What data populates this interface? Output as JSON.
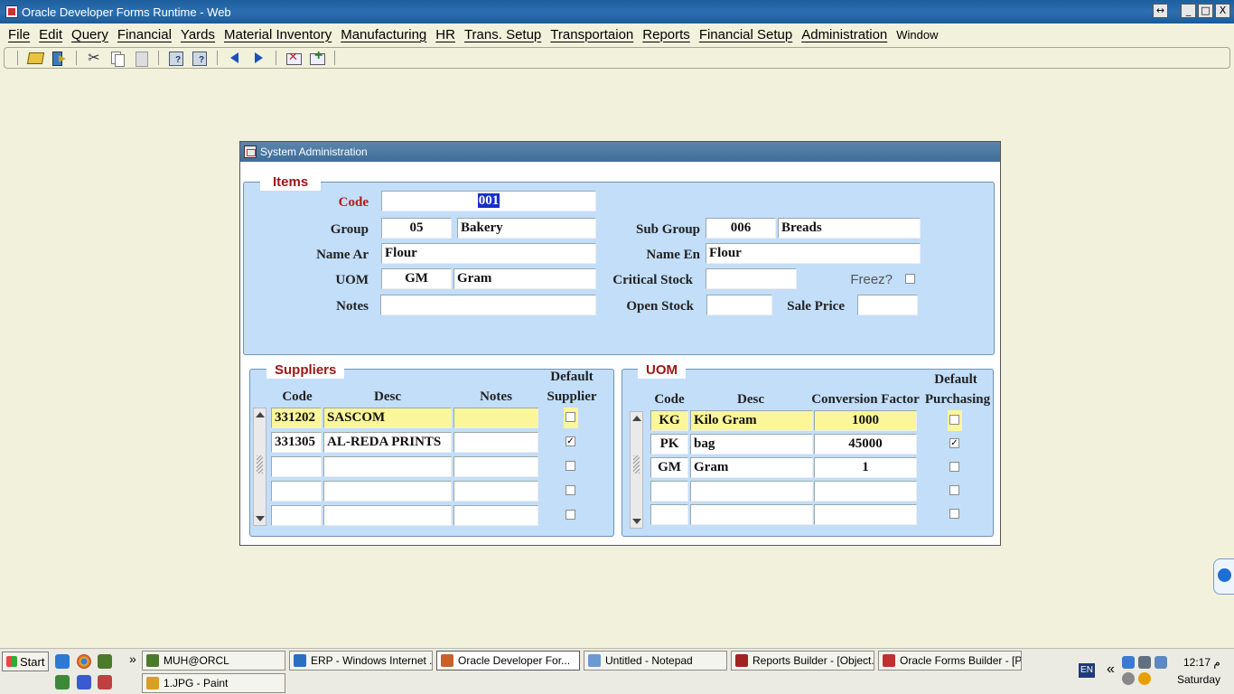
{
  "window": {
    "title": "Oracle Developer Forms Runtime - Web",
    "restore_glyph": "↔",
    "min_glyph": "_",
    "max_glyph": "□",
    "close_glyph": "X"
  },
  "menu": [
    "File",
    "Edit",
    "Query",
    "Financial",
    "Yards",
    "Material Inventory",
    "Manufacturing",
    "HR",
    "Trans. Setup",
    "Transportaion",
    "Reports",
    "Financial Setup",
    "Administration",
    "Window"
  ],
  "toolbar_icons": [
    "open-icon",
    "exit-icon",
    "cut-icon",
    "copy-icon",
    "paste-icon",
    "enter-query-icon",
    "execute-query-icon",
    "previous-record-icon",
    "next-record-icon",
    "delete-record-icon",
    "insert-record-icon"
  ],
  "dialog": {
    "title": "System Administration",
    "items": {
      "legend": "Items",
      "code_label": "Code",
      "code_value": "001",
      "group_label": "Group",
      "group_code": "05",
      "group_name": "Bakery",
      "subgroup_label": "Sub Group",
      "subgroup_code": "006",
      "subgroup_name": "Breads",
      "name_ar_label": "Name Ar",
      "name_ar": "Flour",
      "name_en_label": "Name En",
      "name_en": "Flour",
      "uom_label": "UOM",
      "uom_code": "GM",
      "uom_name": "Gram",
      "critical_stock_label": "Critical Stock",
      "critical_stock": "",
      "freez_label": "Freez?",
      "notes_label": "Notes",
      "notes": "",
      "open_stock_label": "Open Stock",
      "open_stock": "",
      "sale_price_label": "Sale Price",
      "sale_price": ""
    },
    "suppliers": {
      "legend": "Suppliers",
      "headers": {
        "code": "Code",
        "desc": "Desc",
        "notes": "Notes",
        "default1": "Default",
        "default2": "Supplier"
      },
      "rows": [
        {
          "code": "331202",
          "desc": "SASCOM",
          "notes": "",
          "default": ""
        },
        {
          "code": "331305",
          "desc": "AL-REDA PRINTS",
          "notes": "",
          "default": "✓"
        },
        {
          "code": "",
          "desc": "",
          "notes": "",
          "default": ""
        },
        {
          "code": "",
          "desc": "",
          "notes": "",
          "default": ""
        },
        {
          "code": "",
          "desc": "",
          "notes": "",
          "default": ""
        }
      ]
    },
    "uom": {
      "legend": "UOM",
      "headers": {
        "code": "Code",
        "desc": "Desc",
        "factor": "Conversion Factor",
        "default1": "Default",
        "default2": "Purchasing"
      },
      "rows": [
        {
          "code": "KG",
          "desc": "Kilo Gram",
          "factor": "1000",
          "default": ""
        },
        {
          "code": "PK",
          "desc": "bag",
          "factor": "45000",
          "default": "✓"
        },
        {
          "code": "GM",
          "desc": "Gram",
          "factor": "1",
          "default": ""
        },
        {
          "code": "",
          "desc": "",
          "factor": "",
          "default": ""
        },
        {
          "code": "",
          "desc": "",
          "factor": "",
          "default": ""
        }
      ]
    }
  },
  "taskbar": {
    "start": "Start",
    "overflow": "»",
    "tasks": [
      {
        "label": "MUH@ORCL",
        "color": "#4a7a2a"
      },
      {
        "label": "ERP - Windows Internet ...",
        "color": "#2a6fc2"
      },
      {
        "label": "Oracle Developer For...",
        "color": "#c9602a"
      },
      {
        "label": "Untitled - Notepad",
        "color": "#6a9ad0"
      },
      {
        "label": "Reports Builder - [Object...",
        "color": "#a22222"
      },
      {
        "label": "Oracle Forms Builder - [P...",
        "color": "#c03030"
      },
      {
        "label": "1.JPG - Paint",
        "color": "#d8a020"
      }
    ],
    "lang": "EN",
    "tray_chevron": "«",
    "time": "12:17 م",
    "day": "Saturday"
  },
  "colors": {
    "panel": "#c2def9",
    "legend_text": "#9b1616",
    "current_row": "#fbf69a",
    "selection": "#1a2fc8"
  }
}
